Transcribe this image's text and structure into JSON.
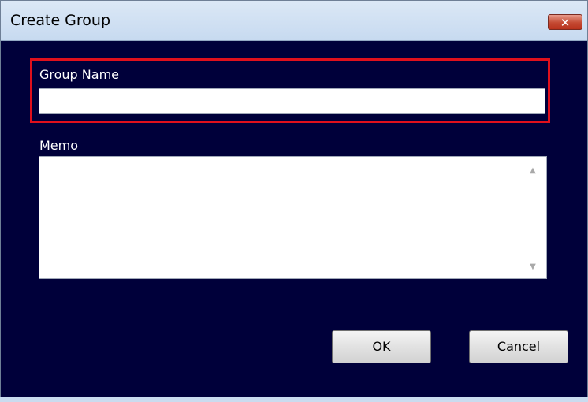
{
  "window": {
    "title": "Create Group",
    "close_glyph": "✕"
  },
  "group_name": {
    "label": "Group Name",
    "value": "",
    "placeholder": ""
  },
  "memo": {
    "label": "Memo",
    "value": "",
    "scroll_up_glyph": "▲",
    "scroll_down_glyph": "▼"
  },
  "buttons": {
    "ok_label": "OK",
    "cancel_label": "Cancel"
  },
  "colors": {
    "dialog_background": "#00003a",
    "highlight": "#e0101c",
    "titlebar": "#d4e4f5"
  },
  "icons": {
    "close": "close-icon",
    "scroll_up": "scroll-up-icon",
    "scroll_down": "scroll-down-icon"
  }
}
